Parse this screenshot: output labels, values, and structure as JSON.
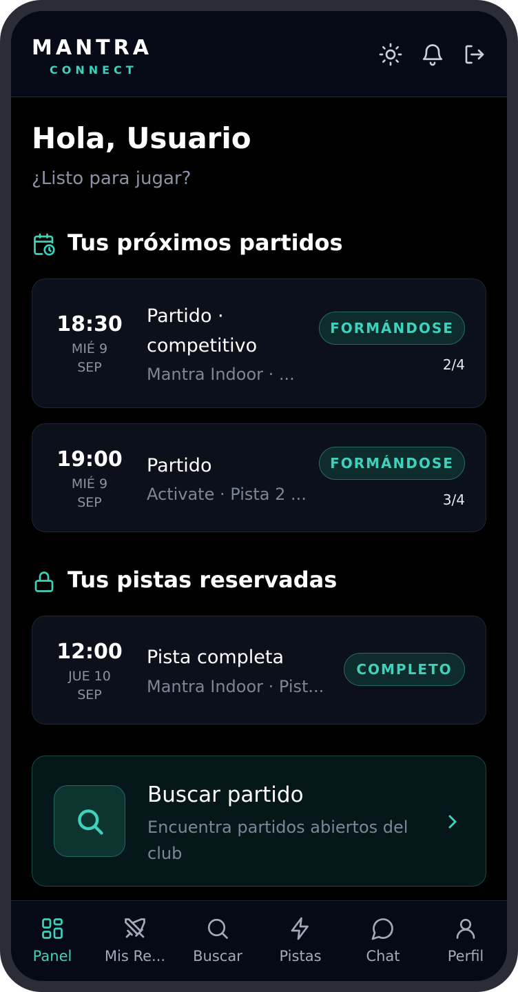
{
  "header": {
    "logo_main": "MANTRA",
    "logo_sub": "CONNECT",
    "icons": [
      "sun-icon",
      "bell-icon",
      "logout-icon"
    ]
  },
  "greeting": {
    "title": "Hola, Usuario",
    "subtitle": "¿Listo para jugar?"
  },
  "upcoming": {
    "title": "Tus próximos partidos",
    "icon": "calendar-clock-icon",
    "matches": [
      {
        "time": "18:30",
        "day": "MIÉ 9",
        "month": "SEP",
        "title_line1": "Partido ·",
        "title_line2": "competitivo",
        "meta": "Mantra Indoor · ...",
        "status": "FORMÁNDOSE",
        "players": "2/4"
      },
      {
        "time": "19:00",
        "day": "MIÉ 9",
        "month": "SEP",
        "title_line1": "Partido",
        "meta": "Activate · Pista 2 ...",
        "status": "FORMÁNDOSE",
        "players": "3/4"
      }
    ]
  },
  "courts": {
    "title": "Tus pistas reservadas",
    "icon": "lock-icon",
    "bookings": [
      {
        "time": "12:00",
        "day": "JUE 10",
        "month": "SEP",
        "title": "Pista completa",
        "meta": "Mantra Indoor · Pist...",
        "status": "COMPLETO"
      }
    ]
  },
  "search_card": {
    "title": "Buscar partido",
    "description": "Encuentra partidos abiertos del club"
  },
  "nav": {
    "items": [
      {
        "label": "Panel",
        "icon": "dashboard-icon",
        "active": true
      },
      {
        "label": "Mis Re...",
        "icon": "swords-icon",
        "active": false
      },
      {
        "label": "Buscar",
        "icon": "search-icon",
        "active": false
      },
      {
        "label": "Pistas",
        "icon": "lightning-icon",
        "active": false
      },
      {
        "label": "Chat",
        "icon": "chat-icon",
        "active": false
      },
      {
        "label": "Perfil",
        "icon": "user-icon",
        "active": false
      }
    ]
  },
  "colors": {
    "accent": "#3fd1bb",
    "background": "#000000",
    "card": "#0b101b"
  }
}
